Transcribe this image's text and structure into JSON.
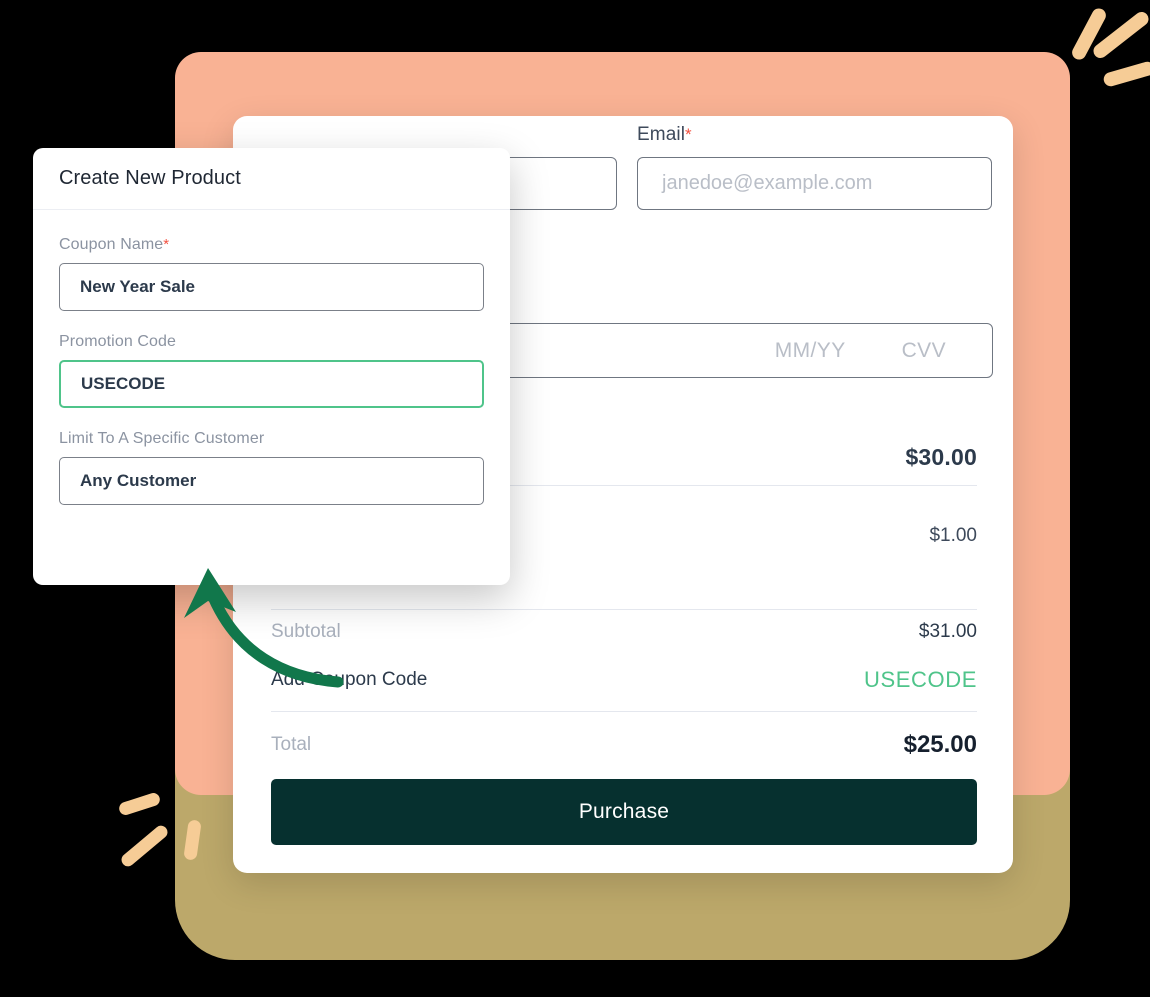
{
  "theme": {
    "peach": "#f9b294",
    "olive": "#bca86a",
    "stroke_tan": "#f6cc96",
    "accent_green": "#4fc48a",
    "arrow_green": "#11774b",
    "button_dark": "#06302f",
    "required_red": "#f2503f"
  },
  "checkout": {
    "email_label": "Email",
    "required_marker": "*",
    "email_placeholder": "janedoe@example.com",
    "name_value": "",
    "card_fields": {
      "expiry_placeholder": "MM/YY",
      "cvv_placeholder": "CVV"
    },
    "line_items": [
      {
        "label": "",
        "price": "$30.00"
      },
      {
        "label": "",
        "price": "$1.00"
      }
    ],
    "summary": [
      {
        "label": "Subtotal",
        "value": "$31.00"
      },
      {
        "label": "Add Coupon Code",
        "value": "USECODE"
      },
      {
        "label": "Total",
        "value": "$25.00"
      }
    ],
    "purchase_label": "Purchase"
  },
  "product_modal": {
    "title": "Create New Product",
    "fields": [
      {
        "label": "Coupon Name",
        "required": "*",
        "value": "New Year Sale"
      },
      {
        "label": "Promotion Code",
        "required": "",
        "value": "USECODE"
      },
      {
        "label": "Limit To A Specific Customer",
        "required": "",
        "value": "Any Customer"
      }
    ]
  }
}
